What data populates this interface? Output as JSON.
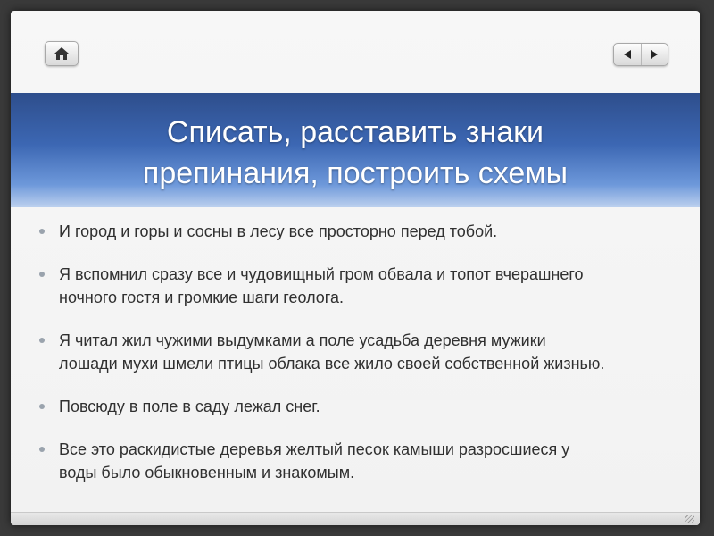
{
  "toolbar": {
    "home_icon": "home-icon",
    "prev_icon": "triangle-left-icon",
    "next_icon": "triangle-right-icon"
  },
  "slide": {
    "title_line1": "Списать, расставить знаки",
    "title_line2": "препинания, построить схемы",
    "bullets": [
      {
        "line1": "И город и  горы и сосны в лесу все просторно перед тобой.",
        "line2": ""
      },
      {
        "line1": "Я вспомнил сразу все и чудовищный гром обвала и топот вчерашнего",
        "line2": "ночного гостя и громкие шаги геолога."
      },
      {
        "line1": "Я читал жил чужими выдумками а поле усадьба деревня мужики",
        "line2": "лошади мухи шмели птицы облака все жило своей собственной жизнью."
      },
      {
        "line1": "Повсюду в поле в саду лежал снег.",
        "line2": ""
      },
      {
        "line1": "Все это раскидистые деревья желтый песок камыши разросшиеся у",
        "line2": "воды было обыкновенным и знакомым."
      }
    ]
  },
  "colors": {
    "title_band_top": "#2e4e8c",
    "title_band_bottom": "#bcd0ee",
    "text": "#303030",
    "bullet": "#9aa3ad"
  }
}
